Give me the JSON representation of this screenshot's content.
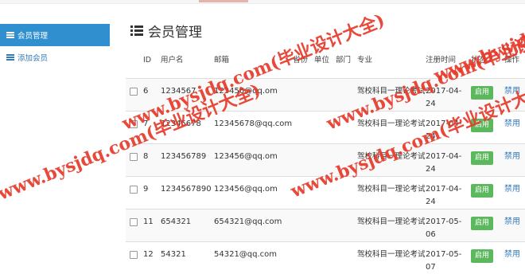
{
  "sidebar": {
    "items": [
      {
        "label": "会员管理"
      },
      {
        "label": "添加会员"
      }
    ]
  },
  "page": {
    "title": "会员管理"
  },
  "table": {
    "headers": {
      "id": "ID",
      "username": "用户名",
      "email": "邮箱",
      "province": "省份",
      "unit": "单位",
      "department": "部门",
      "major": "专业",
      "reg_time": "注册时间",
      "status": "状态",
      "op": "操作"
    },
    "rows": [
      {
        "id": "6",
        "username": "1234567",
        "email": "123456@qq.om",
        "major": "驾校科目一理论考试",
        "reg_time": "2017-04-24",
        "action": "启用",
        "op": "禁用"
      },
      {
        "id": "7",
        "username": "12345678",
        "email": "12345678@qq.com",
        "major": "驾校科目一理论考试",
        "reg_time": "2017-04-24",
        "action": "启用",
        "op": "禁用"
      },
      {
        "id": "8",
        "username": "123456789",
        "email": "123456@qq.om",
        "major": "驾校科目一理论考试",
        "reg_time": "2017-04-24",
        "action": "启用",
        "op": "禁用"
      },
      {
        "id": "9",
        "username": "1234567890",
        "email": "123456@qq.om",
        "major": "驾校科目一理论考试",
        "reg_time": "2017-04-24",
        "action": "启用",
        "op": "禁用"
      },
      {
        "id": "11",
        "username": "654321",
        "email": "654321@qq.com",
        "major": "驾校科目一理论考试",
        "reg_time": "2017-05-06",
        "action": "启用",
        "op": "禁用"
      },
      {
        "id": "12",
        "username": "54321",
        "email": "54321@qq.com",
        "major": "驾校科目一理论考试",
        "reg_time": "2017-05-07",
        "action": "启用",
        "op": "禁用"
      }
    ]
  },
  "watermark": {
    "text": "www.bysjdq.com(毕业设计大全)"
  },
  "colors": {
    "active_sidebar": "#2f8fcf",
    "enable_button": "#5cb85c",
    "watermark": "#e63a2a",
    "link": "#337ab7"
  }
}
